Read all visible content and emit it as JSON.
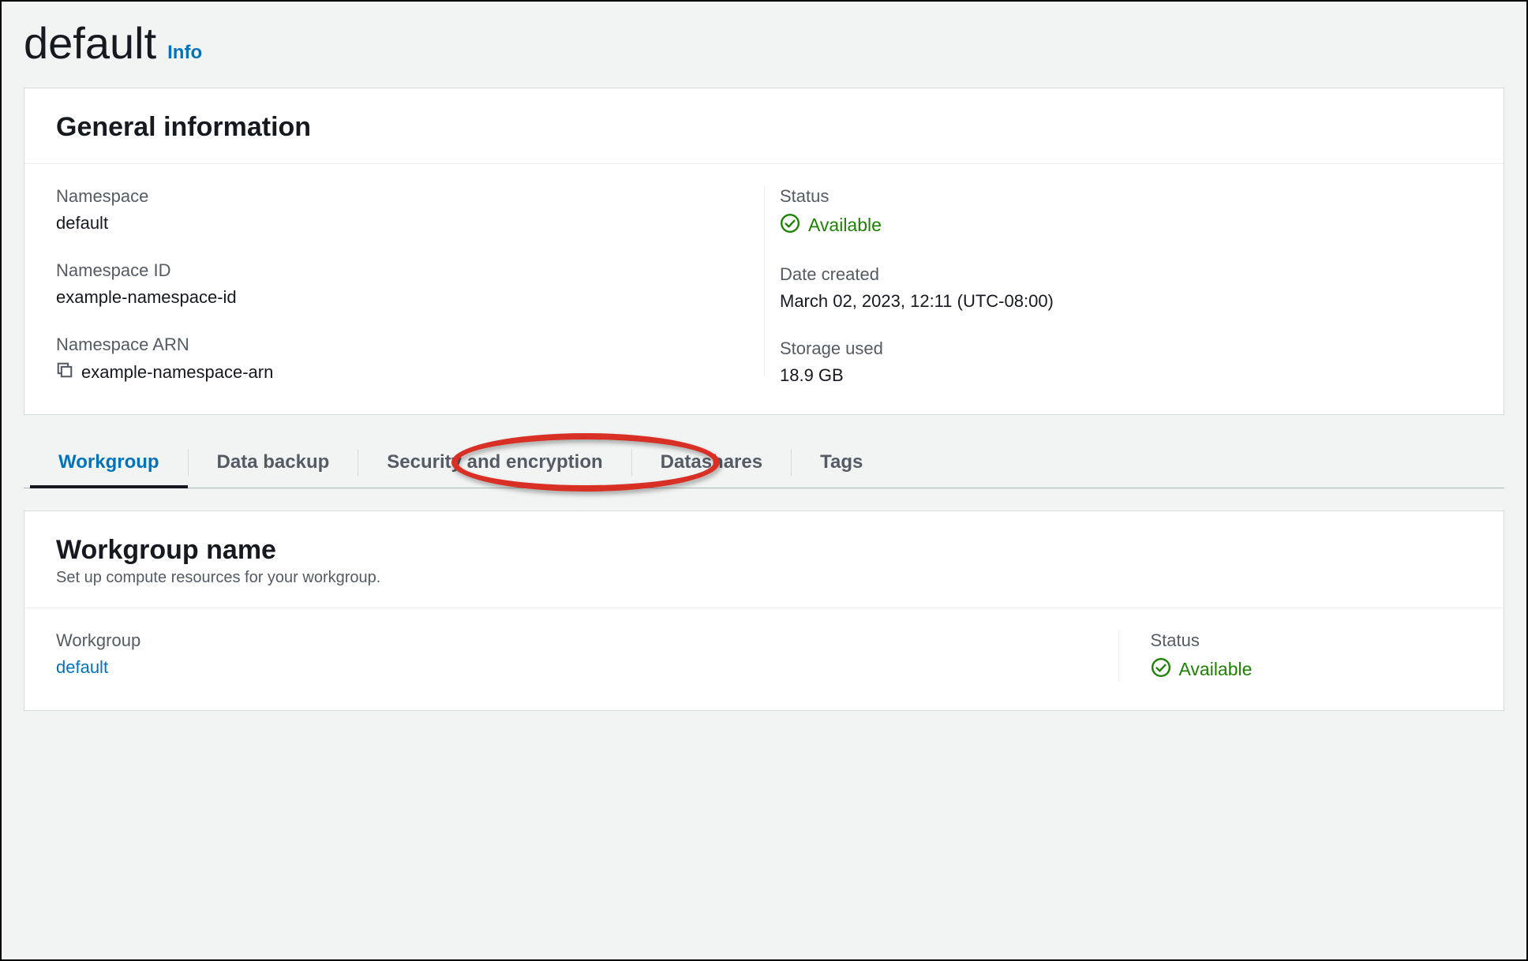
{
  "header": {
    "title": "default",
    "info_label": "Info"
  },
  "general_information": {
    "panel_title": "General information",
    "namespace_label": "Namespace",
    "namespace_value": "default",
    "namespace_id_label": "Namespace ID",
    "namespace_id_value": "example-namespace-id",
    "namespace_arn_label": "Namespace ARN",
    "namespace_arn_value": "example-namespace-arn",
    "status_label": "Status",
    "status_value": "Available",
    "date_created_label": "Date created",
    "date_created_value": "March 02, 2023, 12:11 (UTC-08:00)",
    "storage_used_label": "Storage used",
    "storage_used_value": "18.9 GB"
  },
  "tabs": {
    "workgroup": "Workgroup",
    "data_backup": "Data backup",
    "security_encryption": "Security and encryption",
    "datashares": "Datashares",
    "tags": "Tags"
  },
  "workgroup_panel": {
    "title": "Workgroup name",
    "subtitle": "Set up compute resources for your workgroup.",
    "workgroup_label": "Workgroup",
    "workgroup_value": "default",
    "status_label": "Status",
    "status_value": "Available"
  },
  "colors": {
    "link_blue": "#0073bb",
    "status_green": "#1d8102",
    "highlight_red": "#d93025"
  }
}
